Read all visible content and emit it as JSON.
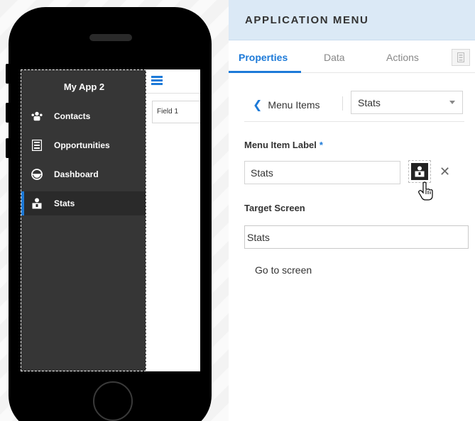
{
  "phone": {
    "app_title": "My App 2",
    "menu_items": [
      {
        "label": "Contacts",
        "icon": "contacts-icon"
      },
      {
        "label": "Opportunities",
        "icon": "opportunities-icon"
      },
      {
        "label": "Dashboard",
        "icon": "dashboard-icon"
      },
      {
        "label": "Stats",
        "icon": "stats-icon",
        "active": true
      }
    ],
    "field_label": "Field 1"
  },
  "panel": {
    "title": "APPLICATION MENU",
    "tabs": [
      "Properties",
      "Data",
      "Actions"
    ],
    "active_tab": "Properties",
    "breadcrumb": {
      "back_label": "Menu Items",
      "selected": "Stats"
    },
    "menu_item_label": {
      "label": "Menu Item Label",
      "required_mark": "*",
      "value": "Stats"
    },
    "target_screen": {
      "label": "Target Screen",
      "value": "Stats"
    },
    "go_to_screen": "Go to screen"
  },
  "colors": {
    "accent": "#1d7ad8",
    "header_bg": "#dbe9f6",
    "menu_bg": "#363636"
  }
}
